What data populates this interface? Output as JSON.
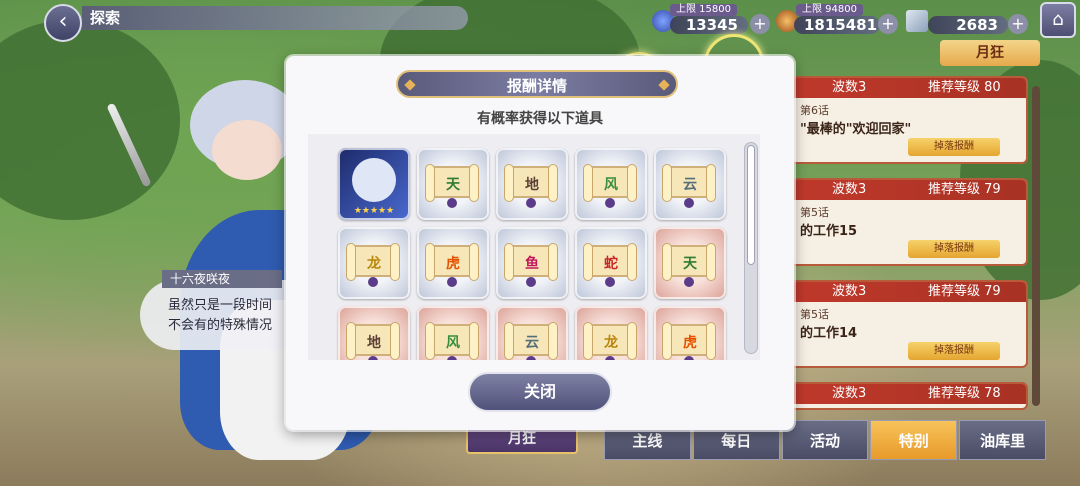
{
  "header": {
    "title": "探索"
  },
  "resources": [
    {
      "label": "上限 15800",
      "value": "13345",
      "icon": "stamina-icon"
    },
    {
      "label": "上限 94800",
      "value": "1815481",
      "icon": "coin-icon"
    },
    {
      "label": "",
      "value": "2683",
      "icon": "crystal-icon"
    }
  ],
  "stage_panel": {
    "mode_badge": "月狂",
    "stages": [
      {
        "wave": "波数3",
        "level": "推荐等级 80",
        "episode": "第6话",
        "name": "\"最棒的\"欢迎回家\"",
        "drop": "掉落报酬"
      },
      {
        "wave": "波数3",
        "level": "推荐等级 79",
        "episode": "第5话",
        "name": "的工作15",
        "drop": "掉落报酬"
      },
      {
        "wave": "波数3",
        "level": "推荐等级 79",
        "episode": "第5话",
        "name": "的工作14",
        "drop": "掉落报酬"
      },
      {
        "wave": "波数3",
        "level": "推荐等级 78",
        "episode": "",
        "name": "",
        "drop": ""
      }
    ]
  },
  "tabs": [
    {
      "label": "主线",
      "active": false
    },
    {
      "label": "每日",
      "active": false
    },
    {
      "label": "活动",
      "active": false
    },
    {
      "label": "特别",
      "active": true
    },
    {
      "label": "油库里",
      "active": false
    }
  ],
  "left_mode_button": "月狂",
  "dialog": {
    "speaker": "十六夜咲夜",
    "text_line1": "虽然只是一段时间",
    "text_line2": "不会有的特殊情况"
  },
  "modal": {
    "title": "报酬详情",
    "subtitle": "有概率获得以下道具",
    "close_label": "关闭",
    "items": [
      {
        "kind": "card",
        "glyph": "",
        "style": "silver"
      },
      {
        "kind": "scroll",
        "glyph": "天",
        "style": "silver",
        "color": "#2e7d32"
      },
      {
        "kind": "scroll",
        "glyph": "地",
        "style": "silver",
        "color": "#5d4037"
      },
      {
        "kind": "scroll",
        "glyph": "风",
        "style": "silver",
        "color": "#388e3c"
      },
      {
        "kind": "scroll",
        "glyph": "云",
        "style": "silver",
        "color": "#546e7a"
      },
      {
        "kind": "scroll",
        "glyph": "龙",
        "style": "silver",
        "color": "#b8860b"
      },
      {
        "kind": "scroll",
        "glyph": "虎",
        "style": "silver",
        "color": "#e65100"
      },
      {
        "kind": "scroll",
        "glyph": "鱼",
        "style": "silver",
        "color": "#c2185b"
      },
      {
        "kind": "scroll",
        "glyph": "蛇",
        "style": "silver",
        "color": "#c62828"
      },
      {
        "kind": "scroll",
        "glyph": "天",
        "style": "pink",
        "color": "#2e7d32"
      },
      {
        "kind": "scroll",
        "glyph": "地",
        "style": "pink",
        "color": "#5d4037"
      },
      {
        "kind": "scroll",
        "glyph": "风",
        "style": "pink",
        "color": "#388e3c"
      },
      {
        "kind": "scroll",
        "glyph": "云",
        "style": "pink",
        "color": "#546e7a"
      },
      {
        "kind": "scroll",
        "glyph": "龙",
        "style": "pink",
        "color": "#b8860b"
      },
      {
        "kind": "scroll",
        "glyph": "虎",
        "style": "pink",
        "color": "#e65100"
      }
    ]
  },
  "colors": {
    "accent_red": "#c0392b",
    "active_tab": "#f7c35a",
    "modal_bg": "#f8f8fa"
  }
}
